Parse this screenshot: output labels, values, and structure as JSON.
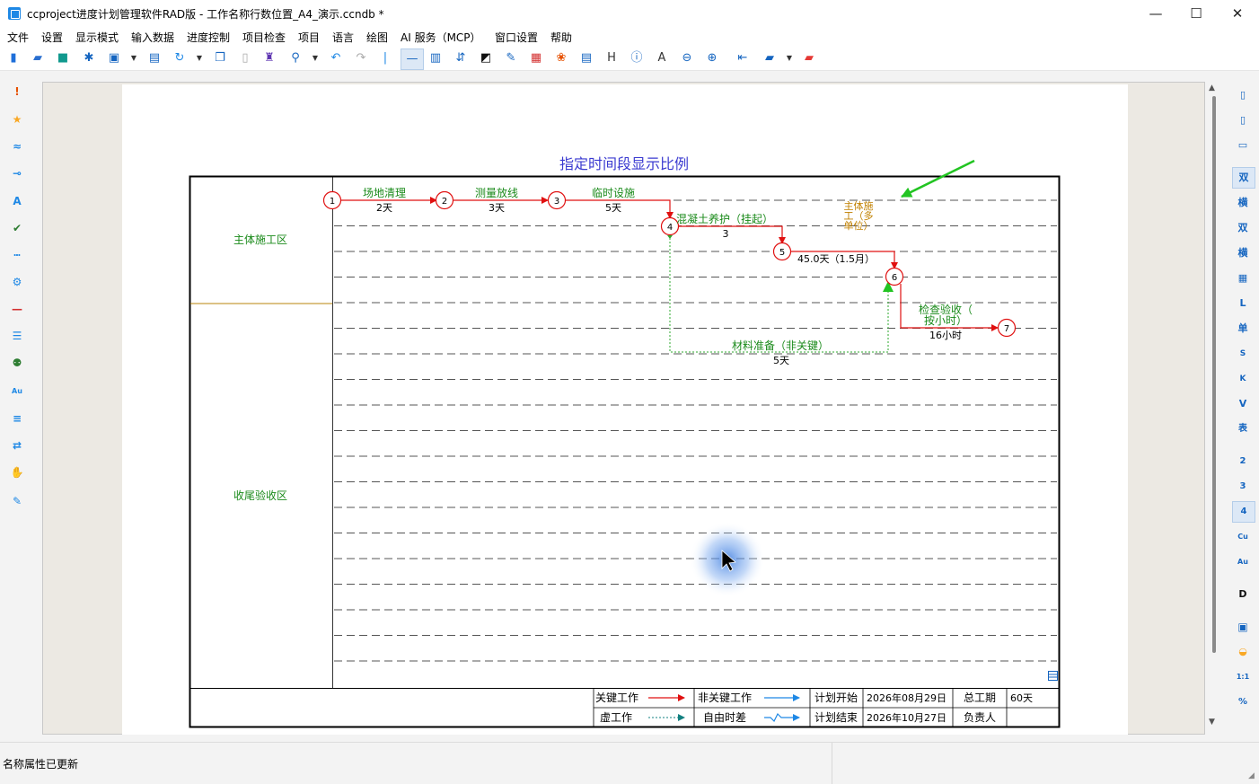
{
  "window": {
    "title": "ccproject进度计划管理软件RAD版 - 工作名称行数位置_A4_演示.ccndb *",
    "minimize": "—",
    "maximize": "☐",
    "close": "✕"
  },
  "menu": [
    "文件",
    "设置",
    "显示模式",
    "输入数据",
    "进度控制",
    "项目检查",
    "项目",
    "语言",
    "绘图",
    "AI 服务（MCP）",
    "窗口设置",
    "帮助"
  ],
  "right_toolbar": [
    "双",
    "横",
    "双",
    "横",
    "▦",
    "L",
    "单",
    "S",
    "K",
    "V",
    "表",
    "2",
    "3",
    "4",
    "Cu",
    "Au",
    "D"
  ],
  "diagram": {
    "title": "指定时间段显示比例",
    "zones": [
      "主体施工区",
      "收尾验收区"
    ],
    "nodes": [
      "1",
      "2",
      "3",
      "4",
      "5",
      "6",
      "7"
    ],
    "tasks": [
      {
        "name": "场地清理",
        "duration": "2天"
      },
      {
        "name": "测量放线",
        "duration": "3天"
      },
      {
        "name": "临时设施",
        "duration": "5天"
      },
      {
        "name": "混凝土养护（挂起）",
        "duration": "3"
      },
      {
        "name": "",
        "duration": "45.0天（1.5月）"
      },
      {
        "name": "检查验收（按小时）",
        "name_line1": "检查验收（",
        "name_line2": "按小时）",
        "duration": "16小时"
      },
      {
        "name": "材料准备（非关键）",
        "duration": "5天"
      }
    ],
    "floating_label": [
      "主体施",
      "工（多",
      "单位）"
    ]
  },
  "legend": {
    "critical": "关键工作",
    "noncritical": "非关键工作",
    "dummy": "虚工作",
    "free_float": "自由时差",
    "plan_start_label": "计划开始",
    "plan_start_value": "2026年08月29日",
    "plan_end_label": "计划结束",
    "plan_end_value": "2026年10月27日",
    "total_duration_label": "总工期",
    "total_duration_value": "60天",
    "owner_label": "负责人",
    "owner_value": ""
  },
  "status": {
    "message": "名称属性已更新"
  },
  "colors": {
    "critical": "#e01010",
    "noncritical": "#1e88e5",
    "dummy": "#2eaa2e",
    "task_text": "#1a8a1a",
    "title": "#3a3ad0",
    "zone_divider": "#b8860b",
    "floating_label": "#c08000"
  }
}
